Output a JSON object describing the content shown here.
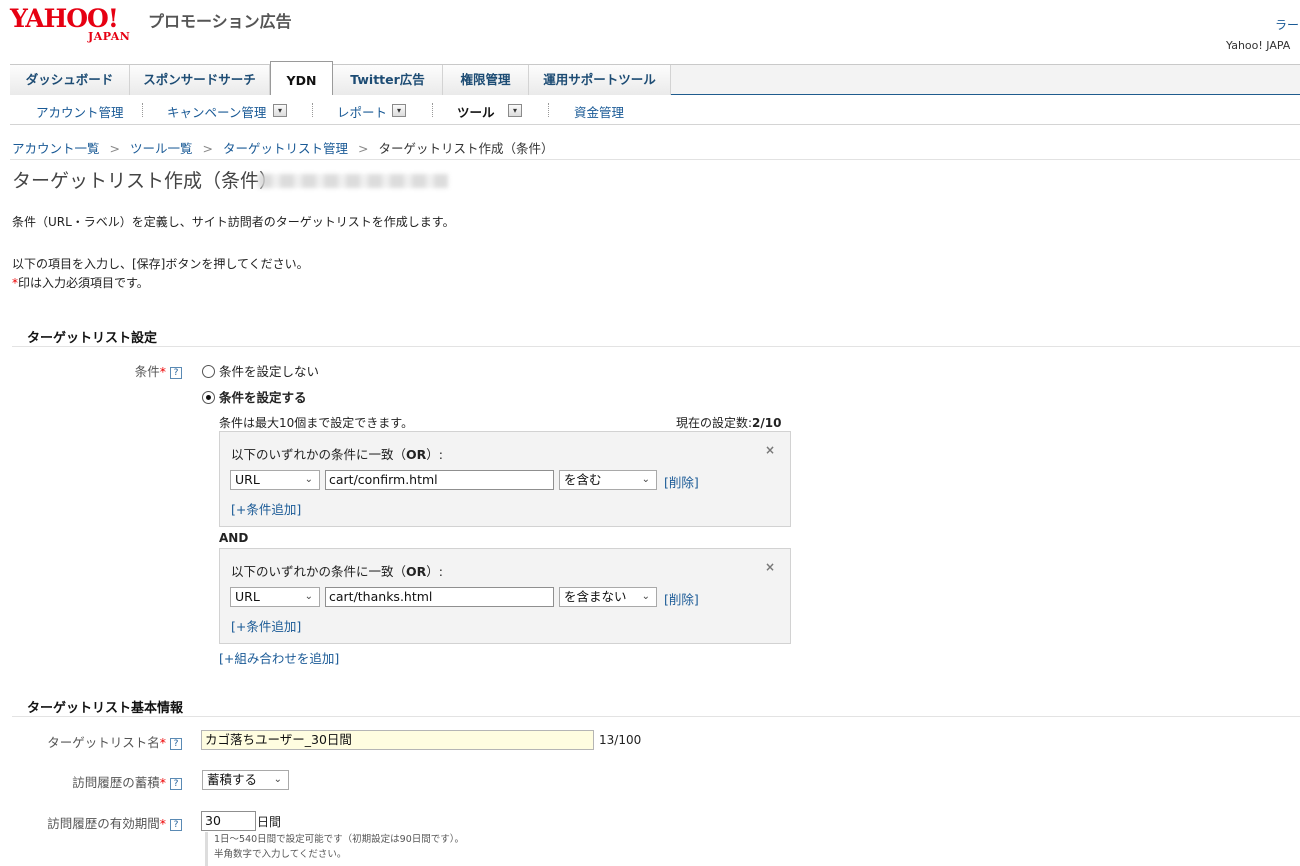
{
  "header": {
    "logo_text": "YAHOO!",
    "logo_sub": "JAPAN",
    "service_name": "プロモーション広告",
    "user_link": "ラー",
    "brand_right": "Yahoo! JAPA"
  },
  "main_tabs": [
    "ダッシュボード",
    "スポンサードサーチ",
    "YDN",
    "Twitter広告",
    "権限管理",
    "運用サポートツール"
  ],
  "sub_nav": {
    "items": [
      "アカウント管理",
      "キャンペーン管理",
      "レポート",
      "ツール",
      "資金管理"
    ],
    "dropdown_glyph": "▾"
  },
  "breadcrumb": {
    "items": [
      "アカウント一覧",
      "ツール一覧",
      "ターゲットリスト管理"
    ],
    "current": "ターゲットリスト作成（条件）",
    "separator": ">"
  },
  "page": {
    "title": "ターゲットリスト作成（条件）",
    "desc1": "条件（URL・ラベル）を定義し、サイト訪問者のターゲットリストを作成します。",
    "desc2": "以下の項目を入力し、[保存]ボタンを押してください。",
    "desc3_star": "*",
    "desc3": "印は入力必須項目です。"
  },
  "settings": {
    "section_title": "ターゲットリスト設定",
    "condition_label": "条件",
    "required_mark": "*",
    "help": "?",
    "radio_none": "条件を設定しない",
    "radio_set": "条件を設定する",
    "max_note": "条件は最大10個まで設定できます。",
    "count_label": "現在の設定数:",
    "count_value": "2/10",
    "close_glyph": "×",
    "groups": [
      {
        "title_prefix": "以下のいずれかの条件に一致（",
        "title_or": "OR",
        "title_suffix": "）:",
        "field": "URL",
        "value": "cart/confirm.html",
        "operator": "を含む",
        "delete_label": "[削除]",
        "add_label": "[+条件追加]"
      },
      {
        "title_prefix": "以下のいずれかの条件に一致（",
        "title_or": "OR",
        "title_suffix": "）:",
        "field": "URL",
        "value": "cart/thanks.html",
        "operator": "を含まない",
        "delete_label": "[削除]",
        "add_label": "[+条件追加]"
      }
    ],
    "and_label": "AND",
    "add_combination": "[+組み合わせを追加]",
    "caret_glyph": "⌄"
  },
  "basic_info": {
    "section_title": "ターゲットリスト基本情報",
    "name_label": "ターゲットリスト名",
    "name_value": "カゴ落ちユーザー_30日間",
    "name_count": "13/100",
    "accumulate_label": "訪問履歴の蓄積",
    "accumulate_value": "蓄積する",
    "period_label": "訪問履歴の有効期間",
    "period_value": "30",
    "period_unit": "日間",
    "note1": "1日～540日間で設定可能です（初期設定は90日間です）。",
    "note2": "半角数字で入力してください。"
  },
  "colors": {
    "brand_red": "#e60012",
    "link_blue": "#1a5a96",
    "required_red": "#e00000",
    "highlight_input": "#fffde0"
  }
}
